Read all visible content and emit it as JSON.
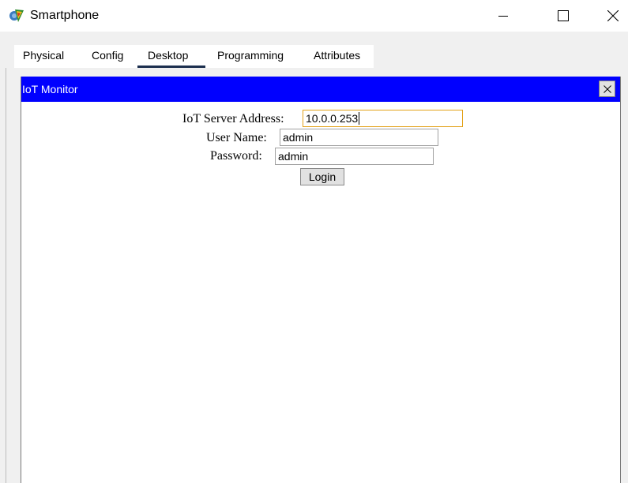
{
  "window": {
    "title": "Smartphone",
    "icon": "packet-tracer-app-icon",
    "controls": {
      "minimize_icon": "minimize-icon",
      "maximize_icon": "maximize-icon",
      "close_icon": "close-icon"
    }
  },
  "tabs": [
    {
      "label": "Physical",
      "active": false
    },
    {
      "label": "Config",
      "active": false
    },
    {
      "label": "Desktop",
      "active": true
    },
    {
      "label": "Programming",
      "active": false
    },
    {
      "label": "Attributes",
      "active": false
    }
  ],
  "iot_monitor": {
    "title": "IoT Monitor",
    "close_label": "X",
    "header_color": "#0000ff",
    "form": {
      "server_label": "IoT Server Address:",
      "server_value": "10.0.0.253",
      "username_label": "User Name:",
      "username_value": "admin",
      "password_label": "Password:",
      "password_value": "admin",
      "login_label": "Login"
    }
  },
  "colors": {
    "focus_border": "#e3a21a",
    "tab_underline": "#1c2f4e",
    "panel_bg": "#f0f0f0"
  }
}
